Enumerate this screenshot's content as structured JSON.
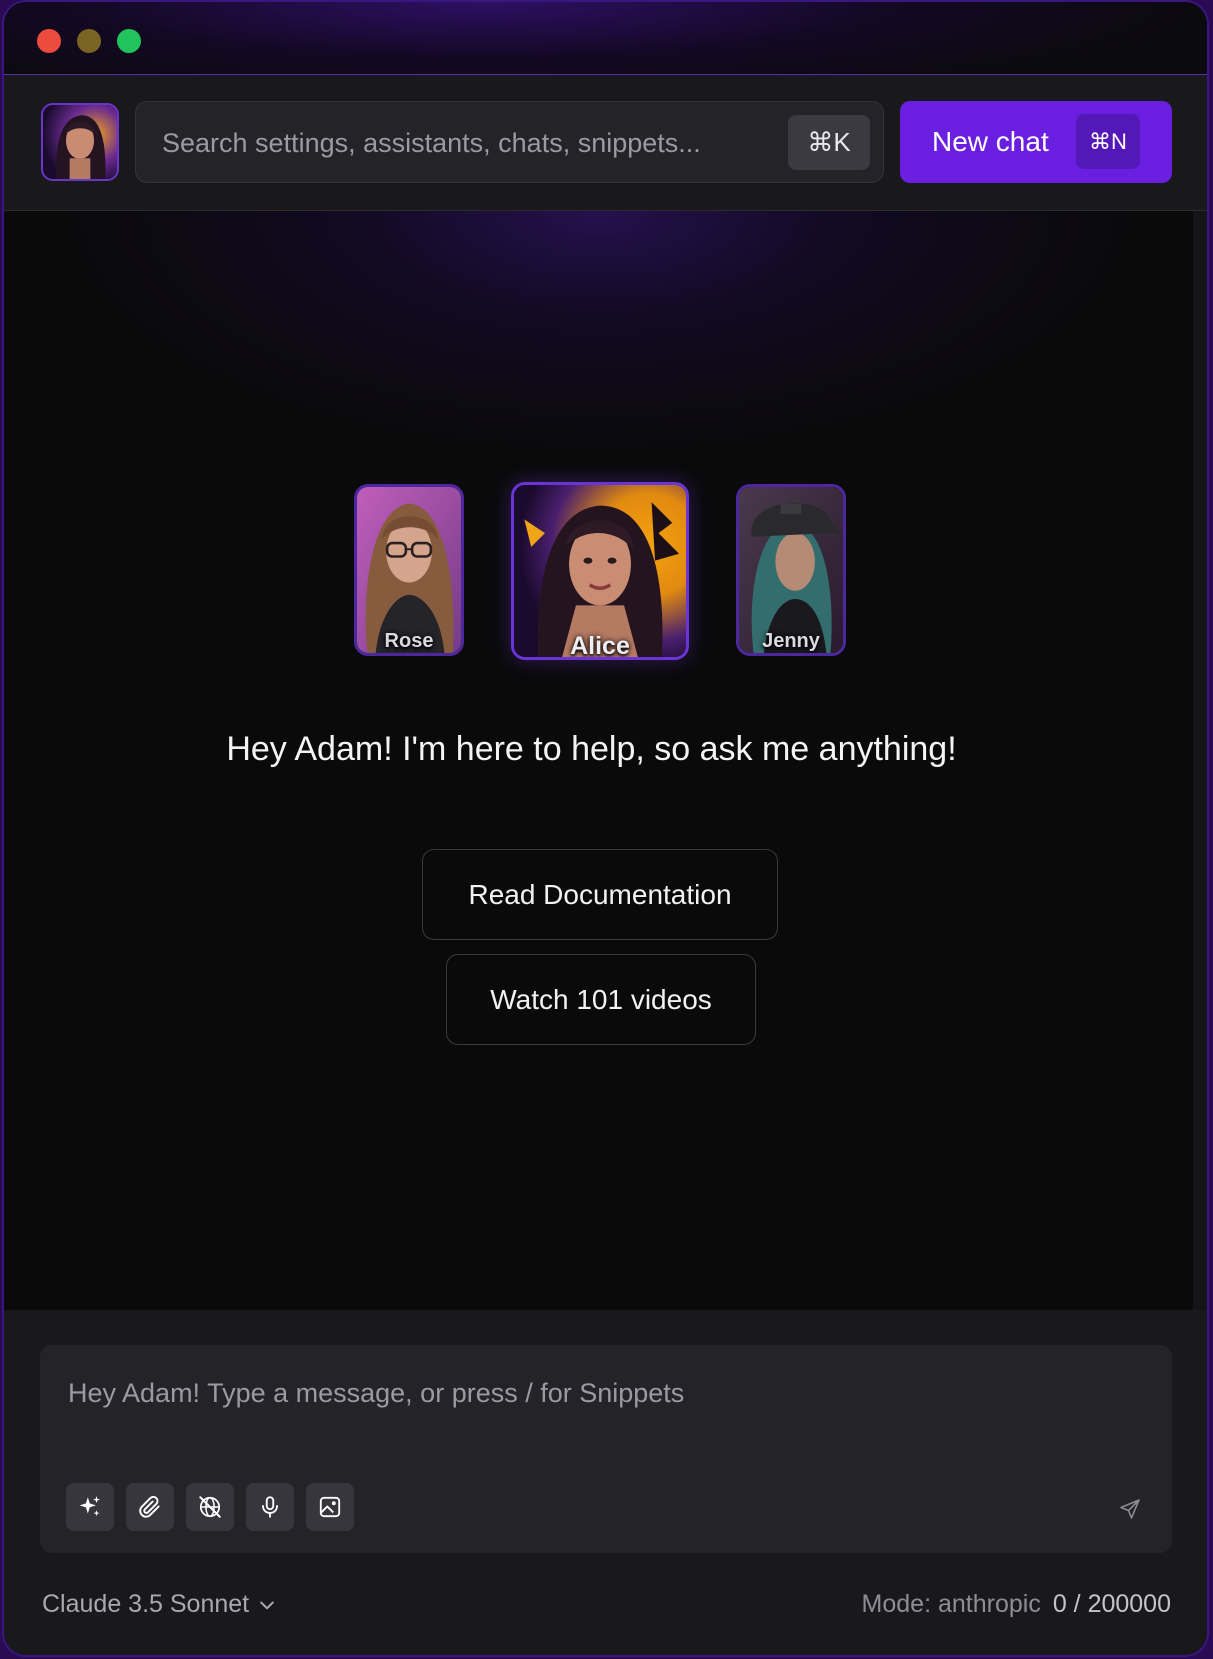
{
  "header": {
    "search_placeholder": "Search settings, assistants, chats, snippets...",
    "search_shortcut": "⌘K",
    "new_chat_label": "New chat",
    "new_chat_shortcut": "⌘N"
  },
  "assistants": [
    {
      "name": "Rose",
      "selected": false
    },
    {
      "name": "Alice",
      "selected": true
    },
    {
      "name": "Jenny",
      "selected": false
    }
  ],
  "main": {
    "greeting": "Hey Adam! I'm here to help, so ask me anything!",
    "read_docs_label": "Read Documentation",
    "watch_videos_label": "Watch 101 videos"
  },
  "composer": {
    "placeholder": "Hey Adam! Type a message, or press / for Snippets",
    "tools": [
      "sparkles-icon",
      "paperclip-icon",
      "globe-off-icon",
      "microphone-icon",
      "image-icon"
    ]
  },
  "footer": {
    "model": "Claude 3.5 Sonnet",
    "mode": "Mode: anthropic",
    "token_count": "0 / 200000"
  },
  "colors": {
    "accent": "#6a1fe0",
    "background": "#0a0a0b",
    "panel": "#19191c",
    "input": "#242428"
  }
}
